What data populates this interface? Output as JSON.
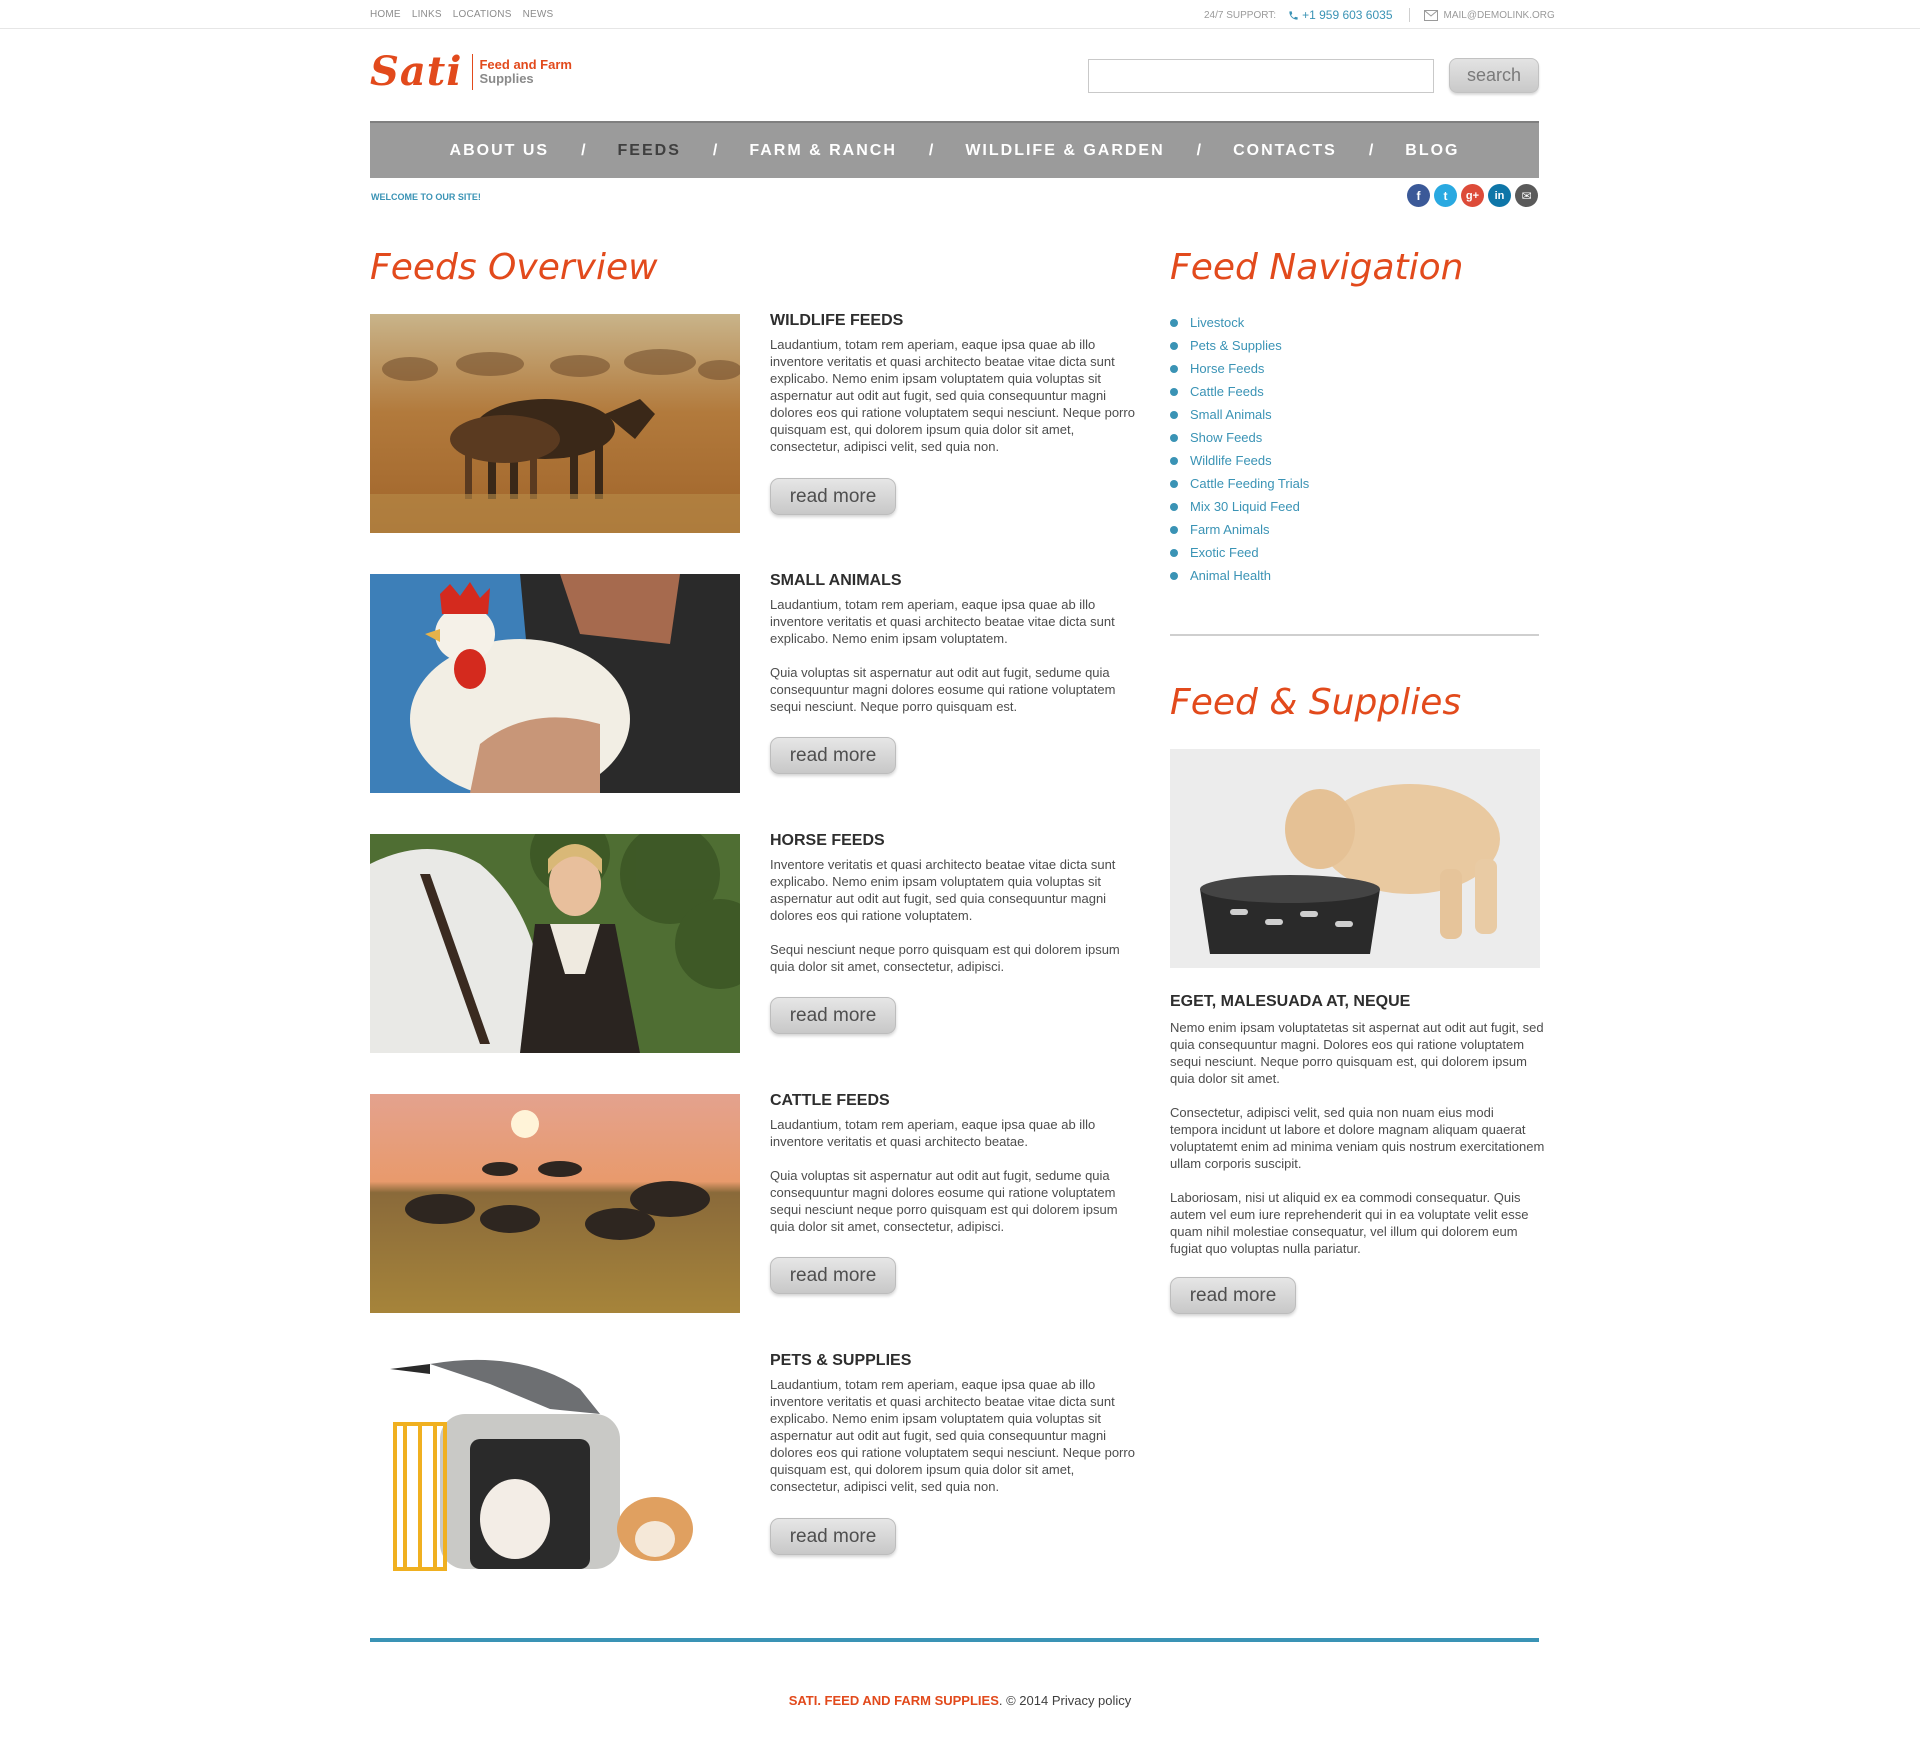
{
  "topbar": {
    "links": [
      "HOME",
      "LINKS",
      "LOCATIONS",
      "NEWS"
    ],
    "support_label": "24/7 SUPPORT:",
    "phone": "+1 959 603 6035",
    "email": "MAIL@DEMOLINK.ORG"
  },
  "logo": {
    "mark": "Sati",
    "line1": "Feed and Farm",
    "line2": "Supplies"
  },
  "search": {
    "value": "",
    "placeholder": "",
    "button": "search"
  },
  "nav": {
    "items": [
      "ABOUT US",
      "FEEDS",
      "FARM & RANCH",
      "WILDLIFE & GARDEN",
      "CONTACTS",
      "BLOG"
    ],
    "separator": "/",
    "active": "FEEDS"
  },
  "welcome": "WELCOME TO OUR SITE!",
  "social": {
    "icons": [
      "facebook-icon",
      "twitter-icon",
      "google-plus-icon",
      "linkedin-icon",
      "email-icon"
    ],
    "glyphs": [
      "f",
      "t",
      "g+",
      "in",
      "✉"
    ],
    "colors": [
      "#3b5998",
      "#29a9e1",
      "#dd4b39",
      "#0e76a8",
      "#5a5a5a"
    ]
  },
  "feeds_overview": {
    "heading": "Feeds Overview",
    "read_more": "read more",
    "items": [
      {
        "title": "WILDLIFE FEEDS",
        "paragraphs": [
          "Laudantium, totam rem aperiam, eaque ipsa quae ab illo inventore veritatis et quasi architecto beatae vitae dicta sunt explicabo. Nemo enim ipsam voluptatem quia voluptas sit aspernatur aut odit aut fugit, sed quia consequuntur magni dolores eos qui ratione voluptatem sequi nesciunt. Neque porro quisquam est, qui dolorem ipsum quia dolor sit amet, consectetur, adipisci velit, sed quia non."
        ]
      },
      {
        "title": "SMALL ANIMALS",
        "paragraphs": [
          "Laudantium, totam rem aperiam, eaque ipsa quae ab illo inventore veritatis et quasi architecto beatae vitae dicta sunt explicabo. Nemo enim ipsam voluptatem.",
          "Quia voluptas sit aspernatur aut odit aut fugit, sedume quia consequuntur magni dolores eosume qui ratione voluptatem sequi nesciunt. Neque porro quisquam est."
        ]
      },
      {
        "title": "HORSE FEEDS",
        "paragraphs": [
          "Inventore veritatis et quasi architecto beatae vitae dicta sunt explicabo. Nemo enim ipsam voluptatem quia voluptas sit aspernatur aut odit aut fugit, sed quia consequuntur magni dolores eos qui ratione voluptatem.",
          "Sequi nesciunt neque porro quisquam est qui dolorem ipsum quia dolor sit amet, consectetur, adipisci."
        ]
      },
      {
        "title": "CATTLE FEEDS",
        "paragraphs": [
          "Laudantium, totam rem aperiam, eaque ipsa quae ab illo inventore veritatis et quasi architecto beatae.",
          "Quia voluptas sit aspernatur aut odit aut fugit, sedume quia consequuntur magni dolores eosume qui ratione voluptatem sequi nesciunt neque porro quisquam est qui dolorem ipsum quia dolor sit amet, consectetur, adipisci."
        ]
      },
      {
        "title": "PETS & SUPPLIES",
        "paragraphs": [
          "Laudantium, totam rem aperiam, eaque ipsa quae ab illo inventore veritatis et quasi architecto beatae vitae dicta sunt explicabo. Nemo enim ipsam voluptatem quia voluptas sit aspernatur aut odit aut fugit, sed quia consequuntur magni dolores eos qui ratione voluptatem sequi nesciunt. Neque porro quisquam est, qui dolorem ipsum quia dolor sit amet, consectetur, adipisci velit, sed quia non."
        ]
      }
    ]
  },
  "feed_navigation": {
    "heading": "Feed Navigation",
    "items": [
      "Livestock",
      "Pets & Supplies",
      "Horse Feeds",
      "Cattle Feeds",
      "Small Animals",
      "Show Feeds",
      "Wildlife Feeds",
      "Cattle Feeding Trials",
      "Mix 30 Liquid Feed",
      "Farm Animals",
      "Exotic Feed",
      "Animal Health"
    ]
  },
  "feed_supplies": {
    "heading": "Feed & Supplies",
    "title": "EGET, MALESUADA AT, NEQUE",
    "paragraphs": [
      "Nemo enim ipsam voluptatetas sit aspernat aut odit aut fugit, sed quia consequuntur magni. Dolores eos qui ratione voluptatem sequi nesciunt. Neque porro quisquam est, qui dolorem ipsum quia dolor sit amet.",
      "Consectetur, adipisci velit, sed quia non nuam eius modi tempora incidunt ut labore et dolore magnam aliquam quaerat voluptatemt enim ad minima veniam quis nostrum exercitationem ullam corporis suscipit.",
      "Laboriosam, nisi ut aliquid ex ea commodi consequatur. Quis autem vel eum iure reprehenderit qui in ea voluptate velit esse quam nihil molestiae consequatur, vel illum qui dolorem eum fugiat quo voluptas nulla pariatur."
    ],
    "read_more": "read more"
  },
  "footer": {
    "brand": "SATI. FEED AND FARM SUPPLIES",
    "copyright": ". © 2014 ",
    "privacy": "Privacy policy"
  },
  "colors": {
    "accent_orange": "#e24a1c",
    "accent_blue": "#3a93b5",
    "nav_gray": "#9b9b9b"
  }
}
